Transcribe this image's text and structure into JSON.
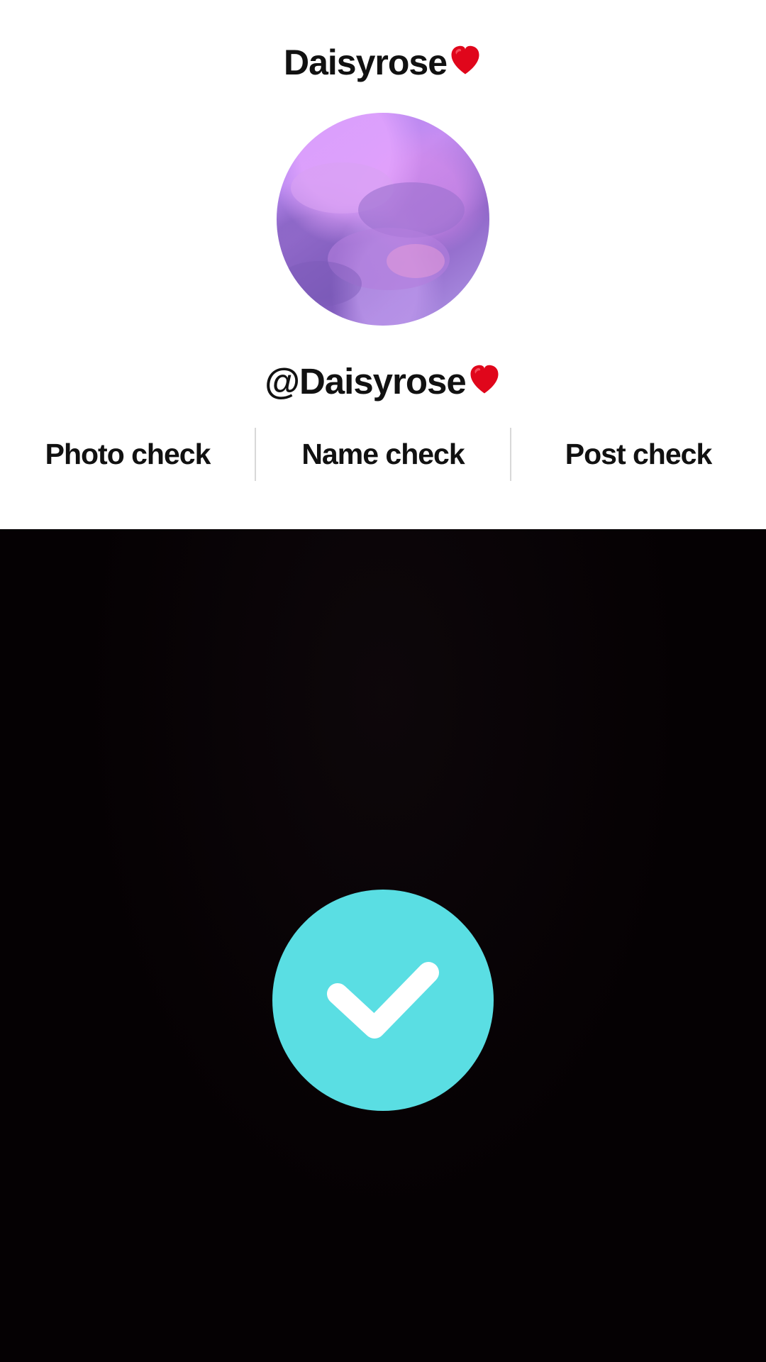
{
  "profile": {
    "display_name": "Daisyrose",
    "username": "@Daisyrose"
  },
  "checks": [
    {
      "label": "Photo check"
    },
    {
      "label": "Name check"
    },
    {
      "label": "Post check"
    }
  ],
  "status": {
    "icon": "checkmark-icon",
    "state": "success"
  },
  "colors": {
    "heart": "#e0061b",
    "success": "#5adee3",
    "background": "#050103"
  }
}
